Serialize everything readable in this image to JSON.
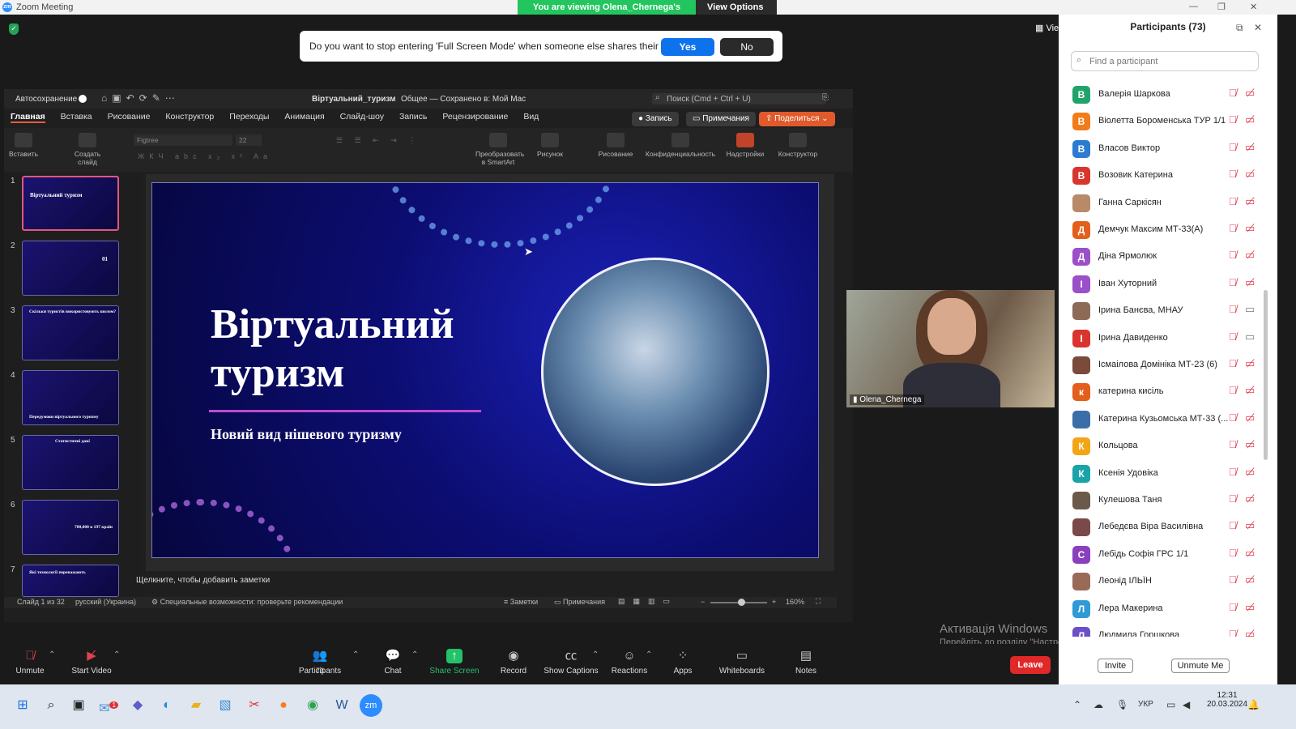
{
  "window": {
    "title": "Zoom Meeting",
    "logo": "zm"
  },
  "share_banner": {
    "text": "You are viewing Olena_Chernega's screen",
    "view_options": "View Options"
  },
  "fullscreen_dialog": {
    "question": "Do you want to stop entering 'Full Screen Mode' when someone else shares their screen?",
    "yes": "Yes",
    "no": "No"
  },
  "view_button": "View",
  "powerpoint": {
    "autosave": "Автосохранение",
    "doc_title": "Віртуальний_туризм",
    "doc_status": "Общее — Сохранено в: Мой Mac",
    "search": "Поиск (Cmd + Ctrl + U)",
    "menu": [
      "Главная",
      "Вставка",
      "Рисование",
      "Конструктор",
      "Переходы",
      "Анимация",
      "Слайд-шоу",
      "Запись",
      "Рецензирование",
      "Вид"
    ],
    "record_btn": "Запись",
    "comments_btn": "Примечания",
    "share_btn": "Поделиться",
    "ribbon": {
      "paste": "Вставить",
      "new_slide": "Создать слайд",
      "font": "Figtree",
      "font_size": "22",
      "smartart": "Преобразовать в SmartArt",
      "picture": "Рисунок",
      "drawing": "Рисование",
      "privacy": "Конфиденциальность",
      "addins": "Надстройки",
      "designer": "Конструктор"
    },
    "thumbnails": [
      {
        "num": "1",
        "text": "Віртуальний туризм"
      },
      {
        "num": "2",
        "text": "01"
      },
      {
        "num": "3",
        "text": "Скільки туристів використовують шолом?"
      },
      {
        "num": "4",
        "text": "Передумови віртуального туризму"
      },
      {
        "num": "5",
        "text": "Статистичні дані"
      },
      {
        "num": "6",
        "text": "700,000 в 197 країн"
      },
      {
        "num": "7",
        "text": "Які технології переважають"
      }
    ],
    "slide": {
      "title_line1": "Віртуальний",
      "title_line2": "туризм",
      "subtitle": "Новий вид нішевого туризму"
    },
    "notes_placeholder": "Щелкните, чтобы добавить заметки",
    "status": {
      "slide": "Слайд 1 из 32",
      "language": "русский (Украина)",
      "accessibility": "Специальные возможности: проверьте рекомендации",
      "notes": "Заметки",
      "comments": "Примечания",
      "zoom": "160%"
    }
  },
  "webcam": {
    "name": "Olena_Chernega"
  },
  "activation": {
    "line1": "Активація Windows",
    "line2": "Перейдіть до розділу \"Настройки\", щоб активувати Windows."
  },
  "toolbar": {
    "unmute": "Unmute",
    "start_video": "Start Video",
    "participants": "Participants",
    "participants_count": "73",
    "chat": "Chat",
    "share_screen": "Share Screen",
    "record": "Record",
    "show_captions": "Show Captions",
    "reactions": "Reactions",
    "apps": "Apps",
    "whiteboards": "Whiteboards",
    "notes": "Notes",
    "leave": "Leave"
  },
  "participants_panel": {
    "title": "Participants (73)",
    "search_placeholder": "Find a participant",
    "invite": "Invite",
    "unmute_me": "Unmute Me",
    "participants": [
      {
        "initial": "В",
        "name": "Валерія Шаркова",
        "color": "#22a36b",
        "video": false
      },
      {
        "initial": "В",
        "name": "Віолетта Бороменська ТУР 1/1",
        "color": "#f07c1a",
        "video": false
      },
      {
        "initial": "В",
        "name": "Власов Виктор",
        "color": "#2b7bd1",
        "video": false
      },
      {
        "initial": "В",
        "name": "Возовик Катерина",
        "color": "#d9352f",
        "video": false
      },
      {
        "initial": "",
        "name": "Ганна Саркісян",
        "color": "#b88a6a",
        "video": false
      },
      {
        "initial": "Д",
        "name": "Демчук Максим МТ-33(А)",
        "color": "#e35f1b",
        "video": false
      },
      {
        "initial": "Д",
        "name": "Діна Ярмолюк",
        "color": "#9b4fc8",
        "video": false
      },
      {
        "initial": "І",
        "name": "Іван Хуторний",
        "color": "#9b4fc8",
        "video": false
      },
      {
        "initial": "",
        "name": "Ірина Банєва, МНАУ",
        "color": "#8c6a55",
        "video": true
      },
      {
        "initial": "І",
        "name": "Ірина Давиденко",
        "color": "#d9352f",
        "video": true
      },
      {
        "initial": "",
        "name": "Ісмаілова Домініка МТ-23 (6)",
        "color": "#7a4a3a",
        "video": false
      },
      {
        "initial": "к",
        "name": "катерина кисіль",
        "color": "#e35f1b",
        "video": false
      },
      {
        "initial": "",
        "name": "Катерина Кузьомська МТ-33 (...",
        "color": "#3a6ea8",
        "video": false
      },
      {
        "initial": "К",
        "name": "Кольцова",
        "color": "#f2a516",
        "video": false
      },
      {
        "initial": "К",
        "name": "Ксенія Удовіка",
        "color": "#1aa3a8",
        "video": false
      },
      {
        "initial": "",
        "name": "Кулешова Таня",
        "color": "#6b5a4a",
        "video": false
      },
      {
        "initial": "",
        "name": "Лебедєва Віра Василівна",
        "color": "#7a4a4a",
        "video": false
      },
      {
        "initial": "С",
        "name": "Лебідь Софія ГРС 1/1",
        "color": "#8a3fbf",
        "video": false
      },
      {
        "initial": "",
        "name": "Леонід ІЛЬЇН",
        "color": "#9a6a58",
        "video": false
      },
      {
        "initial": "Л",
        "name": "Лера Макерина",
        "color": "#2e9ad6",
        "video": false
      },
      {
        "initial": "Л",
        "name": "Людмила Горшкова",
        "color": "#6b4fc8",
        "video": false
      }
    ]
  },
  "taskbar": {
    "lang": "УКР",
    "time": "12:31",
    "date": "20.03.2024",
    "badge": "1"
  }
}
